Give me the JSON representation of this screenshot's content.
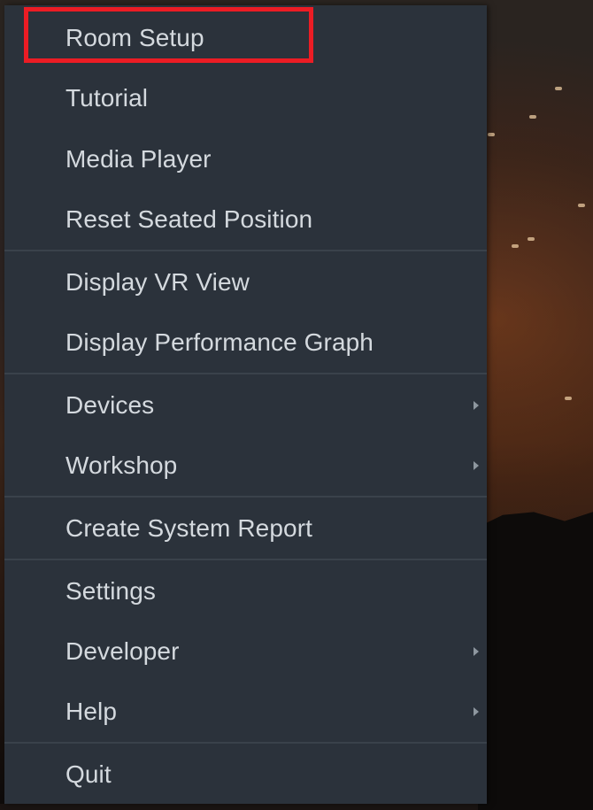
{
  "menu": {
    "items": [
      {
        "label": "Room Setup",
        "submenu": false,
        "highlighted": true
      },
      {
        "label": "Tutorial",
        "submenu": false
      },
      {
        "label": "Media Player",
        "submenu": false
      },
      {
        "label": "Reset Seated Position",
        "submenu": false
      },
      {
        "label": "Display VR View",
        "submenu": false
      },
      {
        "label": "Display Performance Graph",
        "submenu": false
      },
      {
        "label": "Devices",
        "submenu": true
      },
      {
        "label": "Workshop",
        "submenu": true
      },
      {
        "label": "Create System Report",
        "submenu": false
      },
      {
        "label": "Settings",
        "submenu": false
      },
      {
        "label": "Developer",
        "submenu": true
      },
      {
        "label": "Help",
        "submenu": true
      },
      {
        "label": "Quit",
        "submenu": false
      }
    ]
  },
  "colors": {
    "menu_background": "#2b323b",
    "text": "#d4d9de",
    "separator": "#3a424b",
    "highlight": "#ec1c24"
  }
}
